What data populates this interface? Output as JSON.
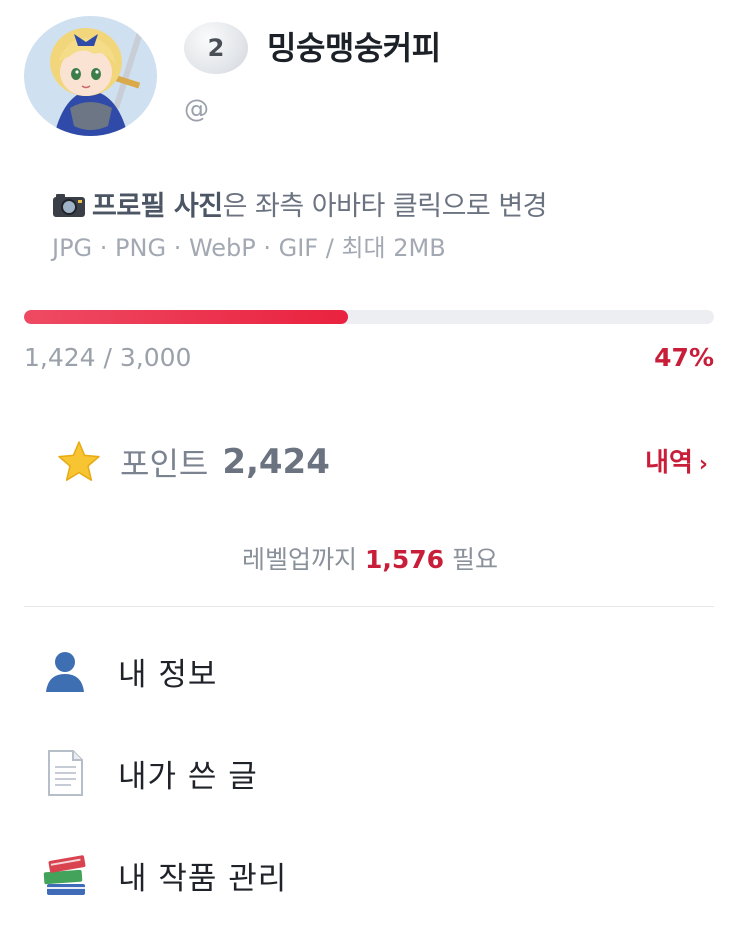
{
  "profile": {
    "level": "2",
    "nickname": "밍숭맹숭커피",
    "handle": "@"
  },
  "upload_hint": {
    "bold": "프로필 사진",
    "rest": "은 좌측 아바타 클릭으로 변경",
    "formats": "JPG · PNG · WebP · GIF / 최대 2MB"
  },
  "progress": {
    "count": "1,424 / 3,000",
    "percent_label": "47%",
    "fraction": 0.47,
    "fill_color": "#e9223f"
  },
  "points": {
    "label": "포인트",
    "value": "2,424",
    "history_label": "내역",
    "history_chevron": "›"
  },
  "levelup": {
    "prefix": "레벨업까지",
    "amount": "1,576",
    "suffix": "필요"
  },
  "menu": [
    {
      "label": "내 정보",
      "icon": "person-icon"
    },
    {
      "label": "내가 쓴 글",
      "icon": "document-icon"
    },
    {
      "label": "내 작품 관리",
      "icon": "books-icon"
    }
  ],
  "colors": {
    "accent": "#c81e3a",
    "muted": "#9aa1aa"
  }
}
